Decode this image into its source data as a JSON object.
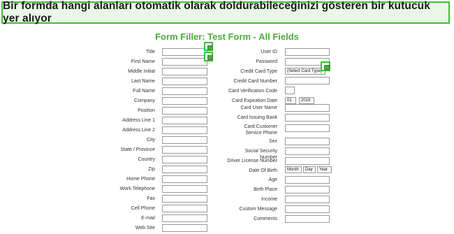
{
  "banner": {
    "text": "Bir formda hangi alanları otomatik olarak doldurabileceğinizi gösteren bir kutucuk yer alıyor"
  },
  "form": {
    "title": "Form Filler: Test Form - All Fields"
  },
  "left_fields": [
    "Title",
    "First Name",
    "Middle Initial",
    "Last Name",
    "Full Name",
    "Company",
    "Position",
    "Address Line 1",
    "Address Line 2",
    "City",
    "State / Province",
    "Country",
    "Zip",
    "Home Phone",
    "Work Telephone",
    "Fax",
    "Cell Phone",
    "E-mail",
    "Web Site"
  ],
  "right_fields": [
    "User ID",
    "Password",
    "Credit Card Type",
    "Credit Card Number",
    "Card Verification Code",
    "Card Expiration Date",
    "Card User Name",
    "Card Issuing Bank",
    "Card Customer Service Phone",
    "Sex",
    "Social Security Number",
    "Driver License Number",
    "Date Of Birth",
    "Age",
    "Birth Place",
    "Income",
    "Custom Message",
    "Comments"
  ],
  "selects": {
    "card_type": "(Select Card Type)",
    "exp_month": "01",
    "exp_year": "2019",
    "dob_month": "Month",
    "dob_day": "Day",
    "dob_year": "Year"
  },
  "colors": {
    "accent": "#3fbf36",
    "title": "#4cae3a",
    "banner_bg": "#e9f7e6"
  },
  "icons": {
    "autofill": "autofill-icon"
  }
}
